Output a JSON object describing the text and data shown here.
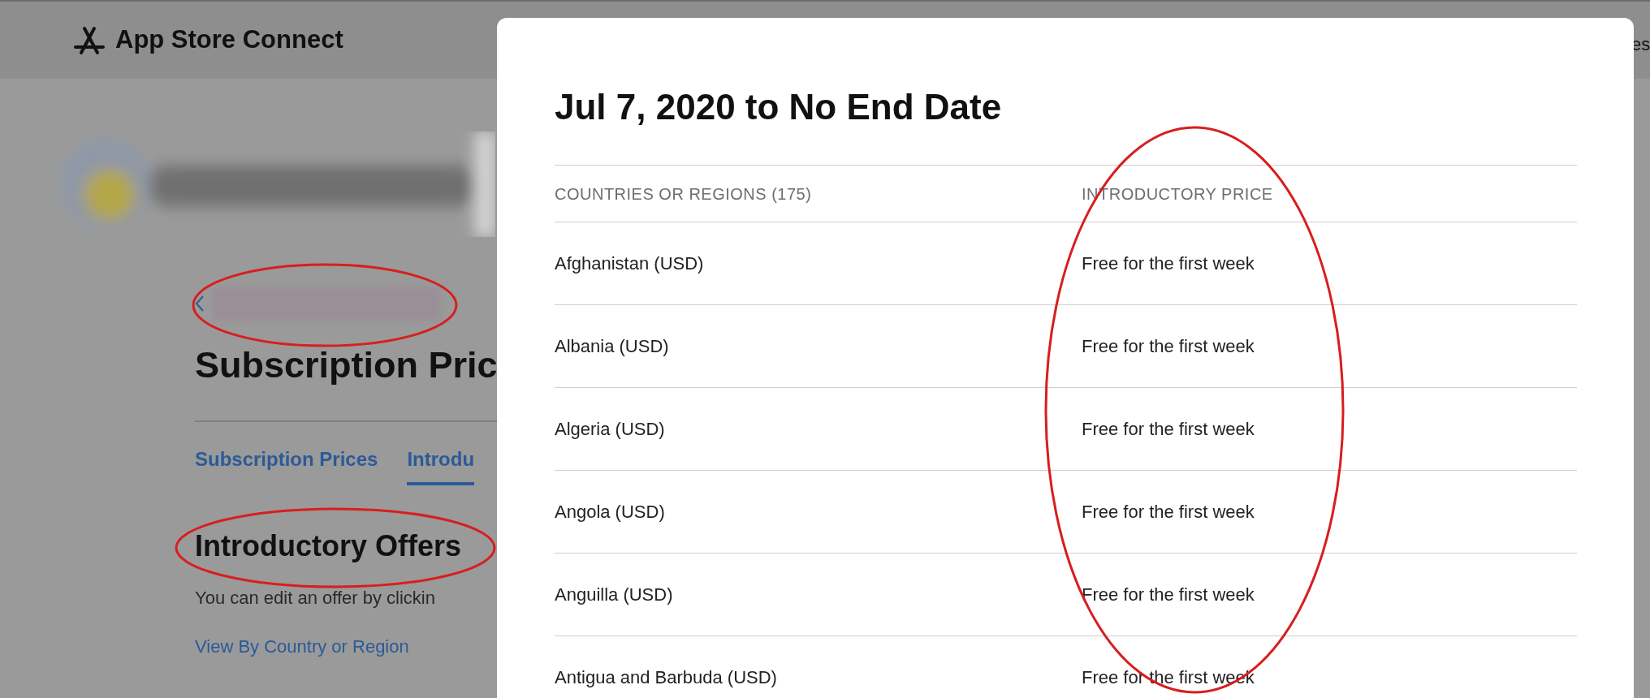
{
  "header": {
    "title": "App Store Connect",
    "right_text": "es"
  },
  "page": {
    "title": "Subscription Pric",
    "tabs": [
      {
        "label": "Subscription Prices",
        "selected": false
      },
      {
        "label": "Introdu",
        "selected": true
      }
    ],
    "section_title": "Introductory Offers",
    "description": "You can edit an offer by clickin",
    "link": "View By Country or Region"
  },
  "modal": {
    "title": "Jul 7, 2020 to No End Date",
    "columns": [
      "COUNTRIES OR REGIONS (175)",
      "INTRODUCTORY PRICE"
    ],
    "rows": [
      [
        "Afghanistan (USD)",
        "Free for the first week"
      ],
      [
        "Albania (USD)",
        "Free for the first week"
      ],
      [
        "Algeria (USD)",
        "Free for the first week"
      ],
      [
        "Angola (USD)",
        "Free for the first week"
      ],
      [
        "Anguilla (USD)",
        "Free for the first week"
      ],
      [
        "Antigua and Barbuda (USD)",
        "Free for the first week"
      ]
    ]
  }
}
